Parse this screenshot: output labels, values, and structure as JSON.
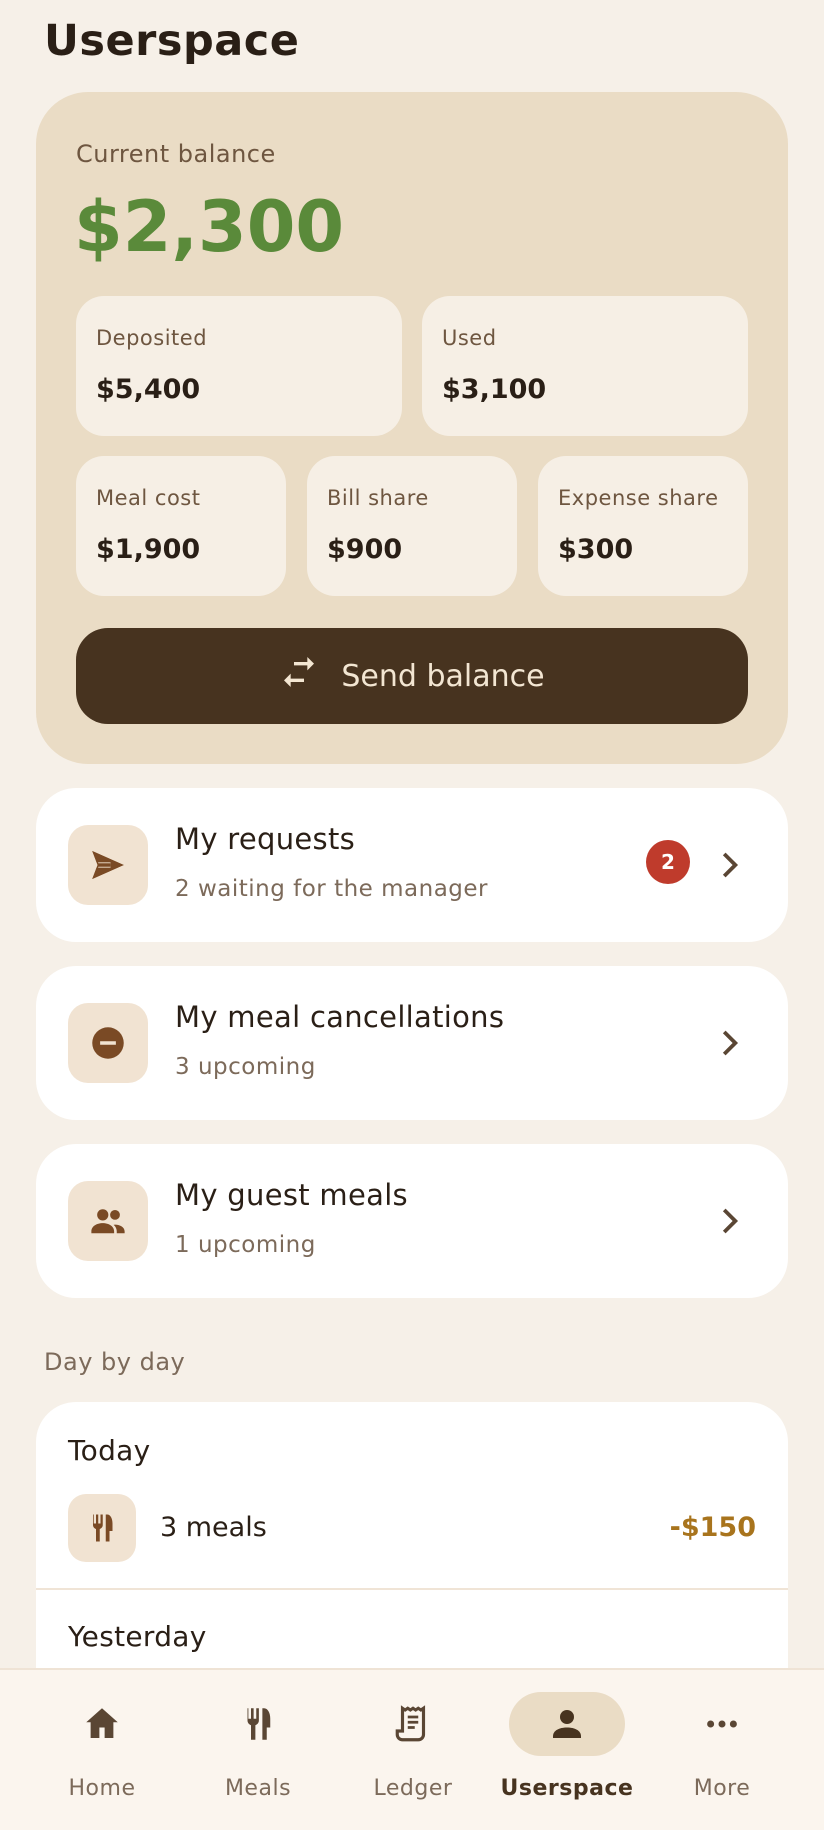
{
  "header": {
    "title": "Userspace"
  },
  "balance": {
    "label": "Current balance",
    "amount": "$2,300",
    "stats_top": [
      {
        "label": "Deposited",
        "value": "$5,400"
      },
      {
        "label": "Used",
        "value": "$3,100"
      }
    ],
    "stats_bottom": [
      {
        "label": "Meal cost",
        "value": "$1,900"
      },
      {
        "label": "Bill share",
        "value": "$900"
      },
      {
        "label": "Expense share",
        "value": "$300"
      }
    ],
    "send_label": "Send balance",
    "colors": {
      "amount": "#5a8a3a",
      "button": "#47331f",
      "card": "#eadcc5"
    }
  },
  "rows": [
    {
      "title": "My requests",
      "subtitle": "2 waiting for the manager",
      "badge": "2",
      "icon": "send-icon"
    },
    {
      "title": "My meal cancellations",
      "subtitle": "3 upcoming",
      "icon": "minus-circle-icon"
    },
    {
      "title": "My guest meals",
      "subtitle": "1 upcoming",
      "icon": "people-icon"
    }
  ],
  "day_by_day": {
    "section_label": "Day by day",
    "days": [
      {
        "heading": "Today",
        "entries": [
          {
            "label": "3 meals",
            "amount": "-$150",
            "icon": "fork-knife-icon"
          }
        ]
      },
      {
        "heading": "Yesterday"
      }
    ]
  },
  "nav": {
    "items": [
      {
        "label": "Home",
        "icon": "home-icon"
      },
      {
        "label": "Meals",
        "icon": "fork-knife-icon"
      },
      {
        "label": "Ledger",
        "icon": "receipt-icon"
      },
      {
        "label": "Userspace",
        "icon": "person-icon",
        "active": true
      },
      {
        "label": "More",
        "icon": "more-icon"
      }
    ]
  }
}
